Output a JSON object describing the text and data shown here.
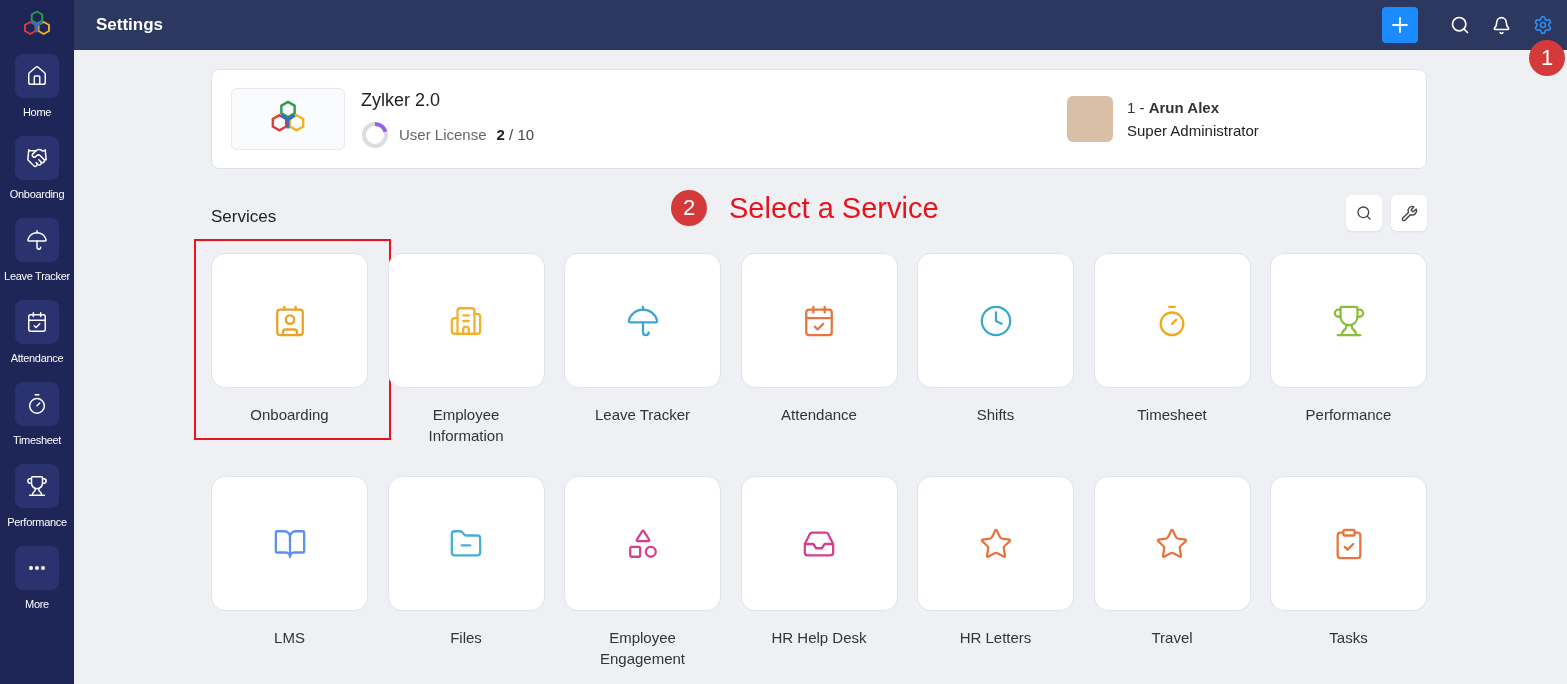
{
  "sidebar": {
    "items": [
      {
        "label": "Home",
        "selected": false
      },
      {
        "label": "Onboarding",
        "selected": false
      },
      {
        "label": "Leave Tracker",
        "selected": false
      },
      {
        "label": "Attendance",
        "selected": false
      },
      {
        "label": "Timesheet",
        "selected": false
      },
      {
        "label": "Performance",
        "selected": false
      },
      {
        "label": "More",
        "selected": false
      }
    ]
  },
  "topbar": {
    "title": "Settings",
    "step_badge": "1"
  },
  "organization": {
    "name": "Zylker 2.0",
    "license_label": "User License",
    "license_used": "2",
    "license_total": "/ 10",
    "level": 0.2
  },
  "admin": {
    "prefix": "1 - ",
    "name": "Arun Alex",
    "role": "Super Administrator"
  },
  "services": {
    "heading": "Services",
    "step_badge": "2",
    "step_text": "Select a Service",
    "items": [
      {
        "label": "Onboarding",
        "highlighted": true
      },
      {
        "label": "Employee Information",
        "highlighted": false
      },
      {
        "label": "Leave Tracker",
        "highlighted": false
      },
      {
        "label": "Attendance",
        "highlighted": false
      },
      {
        "label": "Shifts",
        "highlighted": false
      },
      {
        "label": "Timesheet",
        "highlighted": false
      },
      {
        "label": "Performance",
        "highlighted": false
      },
      {
        "label": "LMS",
        "highlighted": false
      },
      {
        "label": "Files",
        "highlighted": false
      },
      {
        "label": "Employee Engagement",
        "highlighted": false
      },
      {
        "label": "HR Help Desk",
        "highlighted": false
      },
      {
        "label": "HR Letters",
        "highlighted": false
      },
      {
        "label": "Travel",
        "highlighted": false
      },
      {
        "label": "Tasks",
        "highlighted": false
      }
    ]
  }
}
